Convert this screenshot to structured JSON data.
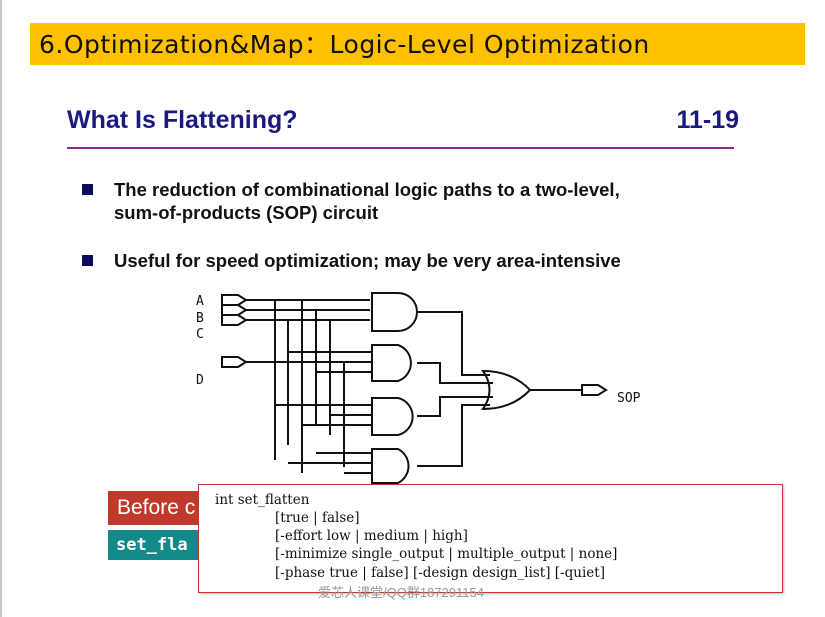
{
  "slide": {
    "title": "6.Optimization&Map：Logic-Level Optimization",
    "heading": "What Is Flattening?",
    "page_number": "11-19",
    "bullets": [
      {
        "line1": "The reduction of combinational logic paths to a two-level,",
        "line2": "sum-of-products (SOP) circuit"
      },
      {
        "line1": "Useful for speed optimization; may be very area-intensive"
      }
    ],
    "diagram": {
      "inputs": [
        "A",
        "B",
        "C",
        "D"
      ],
      "output": "SOP"
    },
    "before_label": "Before c",
    "command_label": "set_fla"
  },
  "popup": {
    "lines": [
      "int set_flatten",
      "[true | false]",
      "[-effort low | medium | high]",
      "[-minimize single_output | multiple_output | none]",
      "[-phase true | false] [-design design_list] [-quiet]"
    ]
  },
  "watermark": "爱芯人课堂/QQ群187291154",
  "colors": {
    "title_bar": "#ffc000",
    "heading": "#1a1a7e",
    "heading_rule": "#8b2a8b",
    "before_label_bg": "#c0392b",
    "command_label_bg": "#138a8a",
    "popup_border": "#c0392b"
  }
}
